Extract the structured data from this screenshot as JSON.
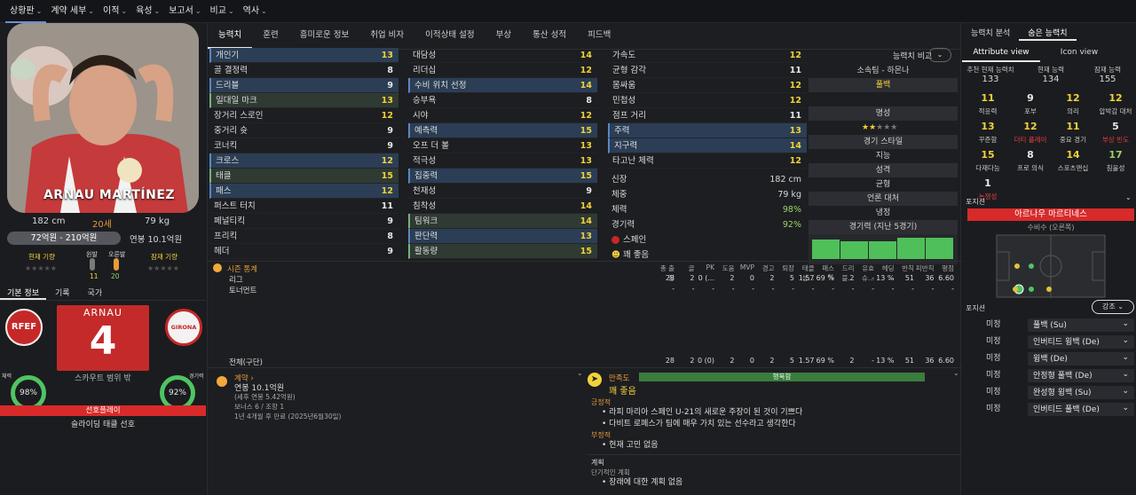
{
  "nav": {
    "items": [
      "상황판",
      "계약 세부",
      "이적",
      "육성",
      "보고서",
      "비교",
      "역사"
    ]
  },
  "player": {
    "name": "ARNAU MARTÍNEZ",
    "height": "182 cm",
    "age": "20세",
    "weight": "79 kg",
    "value": "72억원 - 210억원",
    "wage": "연봉 10.1억원",
    "current_ability_label": "현재 기량",
    "potential_label": "잠재 기량",
    "left_foot_label": "왼발",
    "right_foot_label": "오른발",
    "left_foot_val": "11",
    "right_foot_val": "20",
    "shirt_name": "ARNAU",
    "shirt_number": "4",
    "scout_text": "스카우트 범위 밖",
    "fitness_label": "체력",
    "fitness_val": "98%",
    "condition_label": "경기력",
    "condition_val": "92%",
    "tag": "선호플레이",
    "trait": "슬라이딩 태클 선호",
    "nat_logo": "RFEF",
    "club_logo": "GIRONA"
  },
  "left_tabs": [
    "기본 정보",
    "기록",
    "국가"
  ],
  "mid_tabs": [
    "능력치",
    "훈련",
    "흥미로운 정보",
    "취업 비자",
    "이적상태 설정",
    "부상",
    "통산 성적",
    "피드백"
  ],
  "tech": [
    {
      "l": "개인기",
      "v": "13",
      "c": "y"
    },
    {
      "l": "골 결정력",
      "v": "8",
      "c": "w"
    },
    {
      "l": "드리블",
      "v": "9",
      "c": "w"
    },
    {
      "l": "일대일 마크",
      "v": "13",
      "c": "y"
    },
    {
      "l": "장거리 스로인",
      "v": "12",
      "c": "y"
    },
    {
      "l": "중거리 슛",
      "v": "9",
      "c": "w"
    },
    {
      "l": "코너킥",
      "v": "9",
      "c": "w"
    },
    {
      "l": "크로스",
      "v": "12",
      "c": "y"
    },
    {
      "l": "태클",
      "v": "15",
      "c": "y"
    },
    {
      "l": "패스",
      "v": "12",
      "c": "y"
    },
    {
      "l": "퍼스트 터치",
      "v": "11",
      "c": "w"
    },
    {
      "l": "페널티킥",
      "v": "9",
      "c": "w"
    },
    {
      "l": "프리킥",
      "v": "8",
      "c": "w"
    },
    {
      "l": "헤더",
      "v": "9",
      "c": "w"
    }
  ],
  "mental": [
    {
      "l": "대담성",
      "v": "14",
      "c": "y"
    },
    {
      "l": "리더십",
      "v": "12",
      "c": "y"
    },
    {
      "l": "수비 위치 선정",
      "v": "14",
      "c": "y"
    },
    {
      "l": "승부욕",
      "v": "8",
      "c": "w"
    },
    {
      "l": "시야",
      "v": "12",
      "c": "y"
    },
    {
      "l": "예측력",
      "v": "15",
      "c": "y"
    },
    {
      "l": "오프 더 볼",
      "v": "13",
      "c": "y"
    },
    {
      "l": "적극성",
      "v": "13",
      "c": "y"
    },
    {
      "l": "집중력",
      "v": "15",
      "c": "y"
    },
    {
      "l": "천재성",
      "v": "9",
      "c": "w"
    },
    {
      "l": "침착성",
      "v": "14",
      "c": "y"
    },
    {
      "l": "팀워크",
      "v": "14",
      "c": "y"
    },
    {
      "l": "판단력",
      "v": "13",
      "c": "y"
    },
    {
      "l": "활동량",
      "v": "15",
      "c": "y"
    }
  ],
  "phys": [
    {
      "l": "가속도",
      "v": "12",
      "c": "y"
    },
    {
      "l": "균형 감각",
      "v": "11",
      "c": "w"
    },
    {
      "l": "몸싸움",
      "v": "12",
      "c": "y"
    },
    {
      "l": "민첩성",
      "v": "12",
      "c": "y"
    },
    {
      "l": "점프 거리",
      "v": "11",
      "c": "w"
    },
    {
      "l": "주력",
      "v": "13",
      "c": "y"
    },
    {
      "l": "지구력",
      "v": "14",
      "c": "y"
    },
    {
      "l": "타고난 체력",
      "v": "12",
      "c": "y"
    }
  ],
  "physinfo": [
    {
      "l": "신장",
      "v": "182 cm"
    },
    {
      "l": "체중",
      "v": "79 kg"
    },
    {
      "l": "체력",
      "v": "98%"
    },
    {
      "l": "경기력",
      "v": "92%"
    }
  ],
  "nationality": "스페인",
  "morale_small": "꽤 좋음",
  "compare": {
    "button": "능력치 비교",
    "rows": [
      "소속팀 - 하몬나",
      "풀백",
      "명성",
      "",
      "경기 스타일",
      "지능",
      "성격",
      "균형",
      "언론 대처",
      "냉정",
      "경기력 (지난 5경기)"
    ]
  },
  "season": {
    "title": "시즌 통계",
    "headers": [
      "총 출장",
      "골",
      "PK",
      "도움",
      "MVP",
      "경고",
      "퇴장",
      "태클 성...",
      "패스 %",
      "드리블...",
      "유효 슈...",
      "헤딩 ...",
      "반칙",
      "피반칙",
      "평점"
    ],
    "rows": [
      {
        "name": "리그",
        "vals": [
          "28",
          "2",
          "0 (...",
          "2",
          "0",
          "2",
          "5",
          "1.57",
          "69 %",
          "2",
          "-",
          "13 %",
          "51",
          "36",
          "6.60"
        ]
      },
      {
        "name": "토너먼트",
        "vals": [
          "-",
          "-",
          "-",
          "-",
          "-",
          "-",
          "-",
          "-",
          "-",
          "-",
          "-",
          "-",
          "-",
          "-",
          "-"
        ]
      }
    ],
    "total_label": "전체(구단)",
    "total": [
      "28",
      "2",
      "0 (0)",
      "2",
      "0",
      "2",
      "5",
      "1.57",
      "69 %",
      "2",
      "-",
      "13 %",
      "51",
      "36",
      "6.60"
    ]
  },
  "contract": {
    "title": "계약",
    "wage": "연봉 10.1억원",
    "wage2": "(세후 연봉 5.42억원)",
    "bonus": "보너스 6 / 조항 1",
    "expiry": "1년 4개월 후 만료 (2025년6월30일)"
  },
  "morale": {
    "title": "만족도",
    "status": "꽤 좋음",
    "bar_label": "행복함",
    "pos_title": "긍정적",
    "pos": [
      "라피 마리아 스페인 U-21의 새로운 주장이 된 것이 기쁘다",
      "다비트 로페스가 팀에 매우 가치 있는 선수라고 생각한다"
    ],
    "neg_title": "부정적",
    "neg": [
      "현재 고민 없음"
    ],
    "plan_title": "계획",
    "plan_sub": "단기적인 계획",
    "plan": [
      "장래에 대한 계획 없음"
    ]
  },
  "right": {
    "tabs": [
      "능력치 분석",
      "숨은 능력치"
    ],
    "subtabs": [
      "Attribute view",
      "Icon view"
    ],
    "top": [
      {
        "l": "추천 현재 능력치",
        "v": "133"
      },
      {
        "l": "현재 능력",
        "v": "134"
      },
      {
        "l": "잠재 능력",
        "v": "155"
      }
    ],
    "grid": [
      {
        "v": "11",
        "l": "적응력",
        "c": "y"
      },
      {
        "v": "9",
        "l": "포부",
        "c": "w"
      },
      {
        "v": "12",
        "l": "의리",
        "c": "y"
      },
      {
        "v": "12",
        "l": "압박감 대처",
        "c": "y"
      },
      {
        "v": "13",
        "l": "꾸준함",
        "c": "y"
      },
      {
        "v": "12",
        "l": "더티 플레이",
        "c": "y"
      },
      {
        "v": "11",
        "l": "중요 경기",
        "c": "y"
      },
      {
        "v": "5",
        "l": "부상 빈도",
        "c": "w"
      },
      {
        "v": "15",
        "l": "다재다능",
        "c": "y"
      },
      {
        "v": "8",
        "l": "프로 의식",
        "c": "w"
      },
      {
        "v": "14",
        "l": "스포츠맨십",
        "c": "y"
      },
      {
        "v": "17",
        "l": "침울성",
        "c": "g"
      },
      {
        "v": "1",
        "l": "논쟁성",
        "c": "w"
      }
    ],
    "position_label": "포지션",
    "position_name": "아르나우 마르티네스",
    "position_sub": "수비수 (오른쪽)",
    "roles_label": "포지션",
    "dropdown": "강조",
    "roles": [
      {
        "k": "미정",
        "r": "풀백 (Su)"
      },
      {
        "k": "미정",
        "r": "인버티드 윙백 (De)"
      },
      {
        "k": "미정",
        "r": "윙백 (De)"
      },
      {
        "k": "미정",
        "r": "안정형 풀백 (De)"
      },
      {
        "k": "미정",
        "r": "완성형 윙백 (Su)"
      },
      {
        "k": "미정",
        "r": "인버티드 풀백 (De)"
      }
    ]
  },
  "colors": {
    "accent": "#f2d23b",
    "red": "#d82a2a",
    "green": "#4fc463",
    "blue": "#5b86c4"
  }
}
